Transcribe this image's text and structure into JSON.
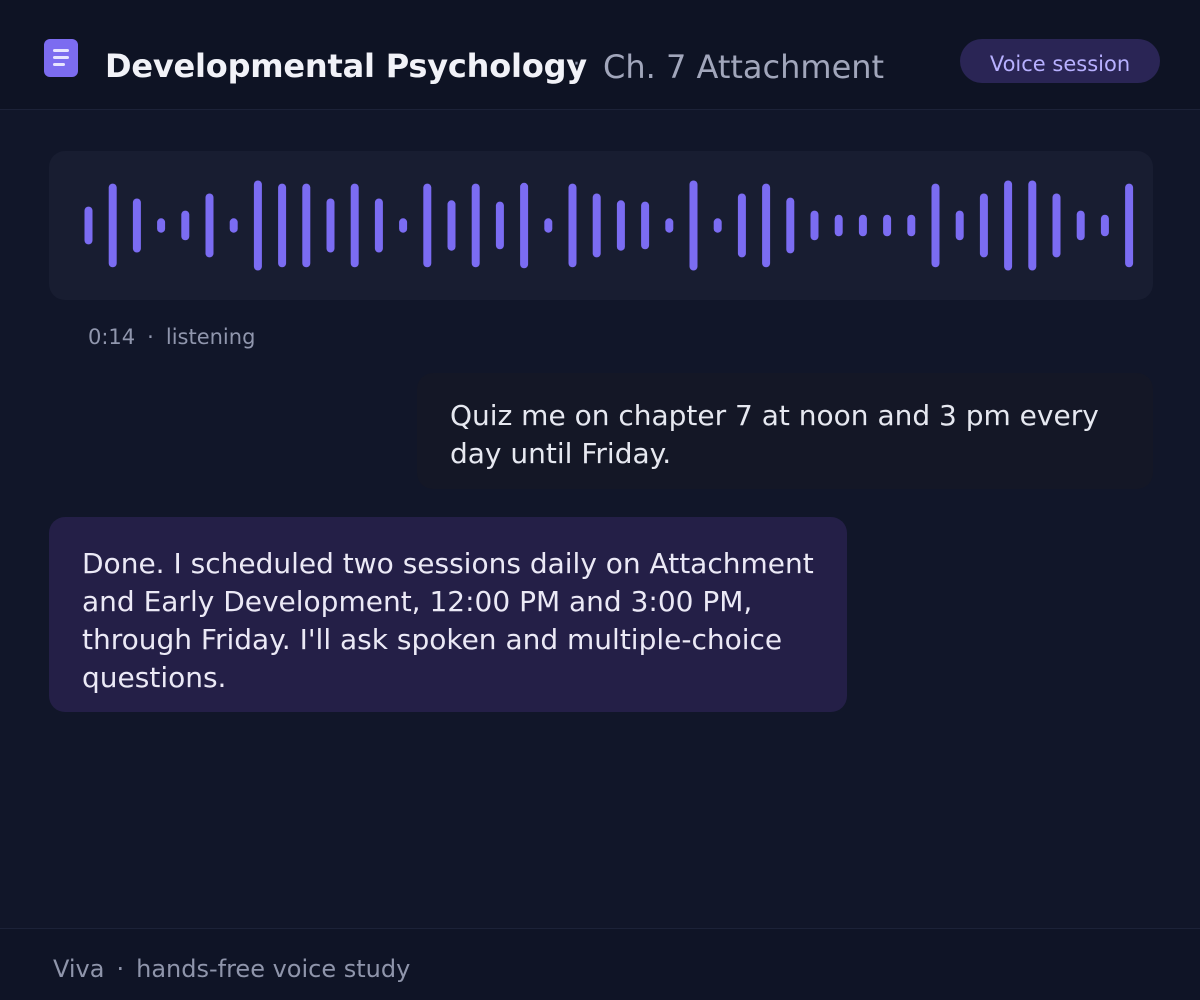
{
  "header": {
    "title": "Developmental Psychology",
    "separator": "·",
    "chapter": "Ch. 7 Attachment",
    "mode_badge": "Voice session",
    "icon": "document-icon"
  },
  "waveform": {
    "accent_color": "#7b6cf2",
    "levels": [
      0.42,
      0.93,
      0.6,
      0.16,
      0.33,
      0.71,
      0.16,
      1.0,
      0.93,
      0.93,
      0.6,
      0.93,
      0.6,
      0.16,
      0.93,
      0.56,
      0.93,
      0.53,
      0.95,
      0.16,
      0.93,
      0.71,
      0.56,
      0.53,
      0.16,
      1.0,
      0.16,
      0.71,
      0.93,
      0.62,
      0.33,
      0.24,
      0.24,
      0.24,
      0.24,
      0.93,
      0.33,
      0.71,
      1.0,
      1.0,
      0.71,
      0.33,
      0.24,
      0.93
    ]
  },
  "status": {
    "time": "0:14",
    "separator": "·",
    "state": "listening"
  },
  "messages": {
    "user": "Quiz me on chapter 7 at noon and 3 pm every day until Friday.",
    "assistant": "Done. I scheduled two sessions daily on Attachment and Early Development, 12:00 PM and 3:00 PM, through Friday. I'll ask spoken and multiple-choice questions."
  },
  "footer": {
    "brand": "Viva",
    "separator": "·",
    "tagline": "hands-free voice study"
  }
}
